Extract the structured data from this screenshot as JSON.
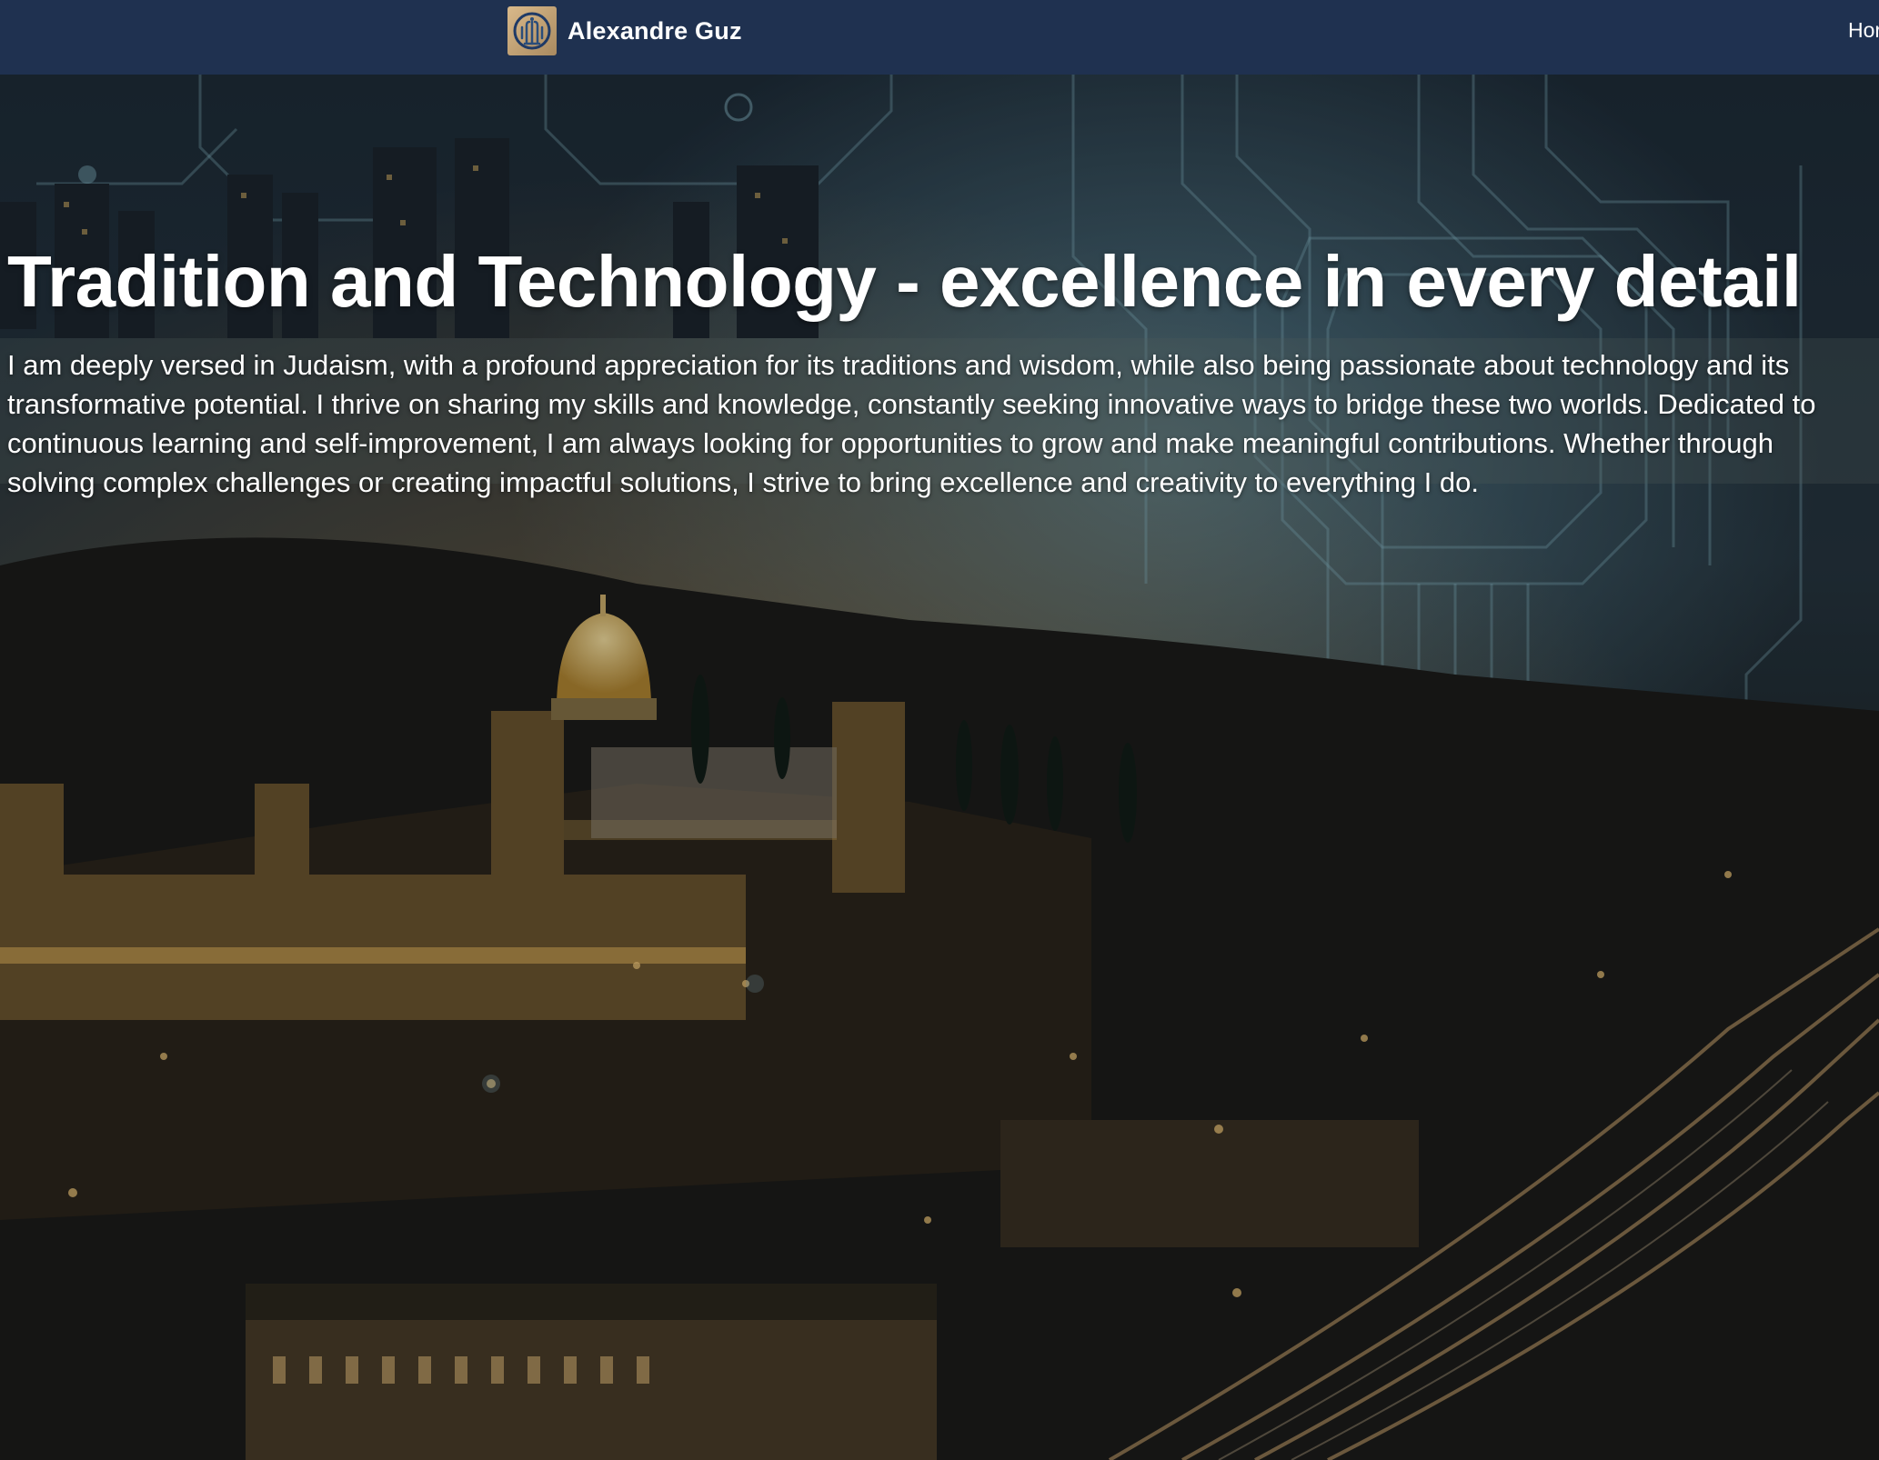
{
  "navbar": {
    "brand_name": "Alexandre Guz",
    "logo_icon": "circuit-menorah-logo",
    "nav_link": "Hor",
    "background_color": "#1f3150"
  },
  "hero": {
    "title": "Tradition and Technology - excellence in every detail",
    "description": "I am deeply versed in Judaism, with a profound appreciation for its traditions and wisdom, while also being passionate about technology and its transformative potential. I thrive on sharing my skills and knowledge, constantly seeking innovative ways to bridge these two worlds. Dedicated to continuous learning and self-improvement, I am always looking for opportunities to grow and make meaningful contributions. Whether through solving complex challenges or creating impactful solutions, I strive to bring excellence and creativity to everything I do.",
    "background_image": "jerusalem-night-circuit-overlay"
  }
}
